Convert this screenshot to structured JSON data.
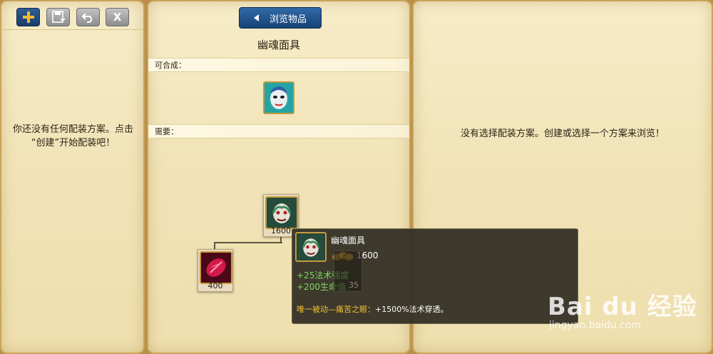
{
  "left_panel": {
    "toolbar": {
      "add_icon": "plus-icon",
      "save_icon": "save-icon",
      "undo_icon": "undo-icon",
      "close_icon": "close-icon",
      "close_label": "X"
    },
    "message_line1": "你还没有任何配装方案。点击",
    "message_line2": "“创建”开始配装吧！"
  },
  "middle_panel": {
    "tab_label": "浏览物品",
    "item_title": "幽魂面具",
    "craftable_label": "可合成：",
    "requires_label": "需要：",
    "tree_root_price": "1600",
    "tree_child_price": "400",
    "tree_child2_price": "35"
  },
  "right_panel": {
    "message": "没有选择配装方案。创建或选择一个方案来浏览！"
  },
  "tooltip": {
    "name": "幽魂面具",
    "price": "1600",
    "stat1": "+25法术强度",
    "stat2": "+200生命值",
    "passive_label": "唯一被动—痛苦之眼：",
    "passive_text": "+1500%法术穿透。"
  },
  "watermark": {
    "logo": "Bai du 经验",
    "url": "jingyan.baidu.com"
  },
  "colors": {
    "panel_bg": "#f1e3b6",
    "accent_blue": "#2f6aa6",
    "stat_green": "#7fd85f",
    "passive_gold": "#f2c030"
  }
}
